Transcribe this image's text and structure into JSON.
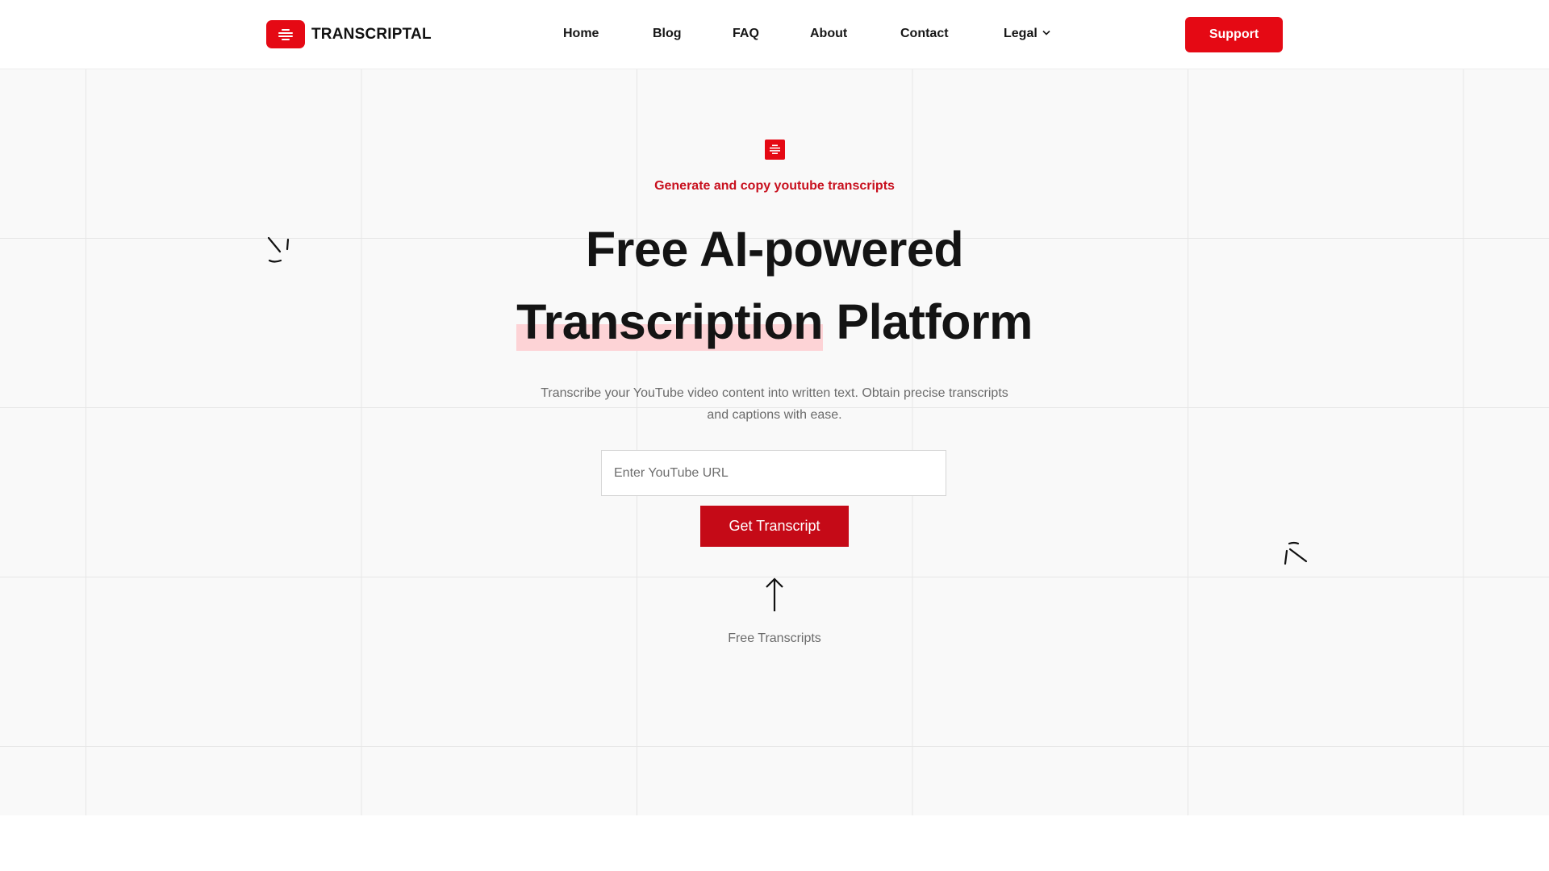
{
  "brand": {
    "name": "TRANSCRIPTAL",
    "logo_icon": "transcript-lines-icon",
    "accent_color": "#e50914"
  },
  "nav": {
    "items": [
      {
        "label": "Home"
      },
      {
        "label": "Blog"
      },
      {
        "label": "FAQ"
      },
      {
        "label": "About"
      },
      {
        "label": "Contact"
      },
      {
        "label": "Legal",
        "has_dropdown": true
      }
    ],
    "support_label": "Support"
  },
  "hero": {
    "icon": "transcript-lines-icon",
    "tagline": "Generate and copy youtube transcripts",
    "headline_line1": "Free AI-powered",
    "headline_highlight": "Transcription",
    "headline_rest": "Platform",
    "subtitle": "Transcribe your YouTube video content into written text. Obtain precise transcripts and captions with ease.",
    "input_placeholder": "Enter YouTube URL",
    "input_value": "",
    "cta_label": "Get Transcript",
    "arrow_icon": "arrow-up-icon",
    "footer_note": "Free Transcripts",
    "highlight_color": "#fdd3d6",
    "cta_color": "#c50a17"
  }
}
